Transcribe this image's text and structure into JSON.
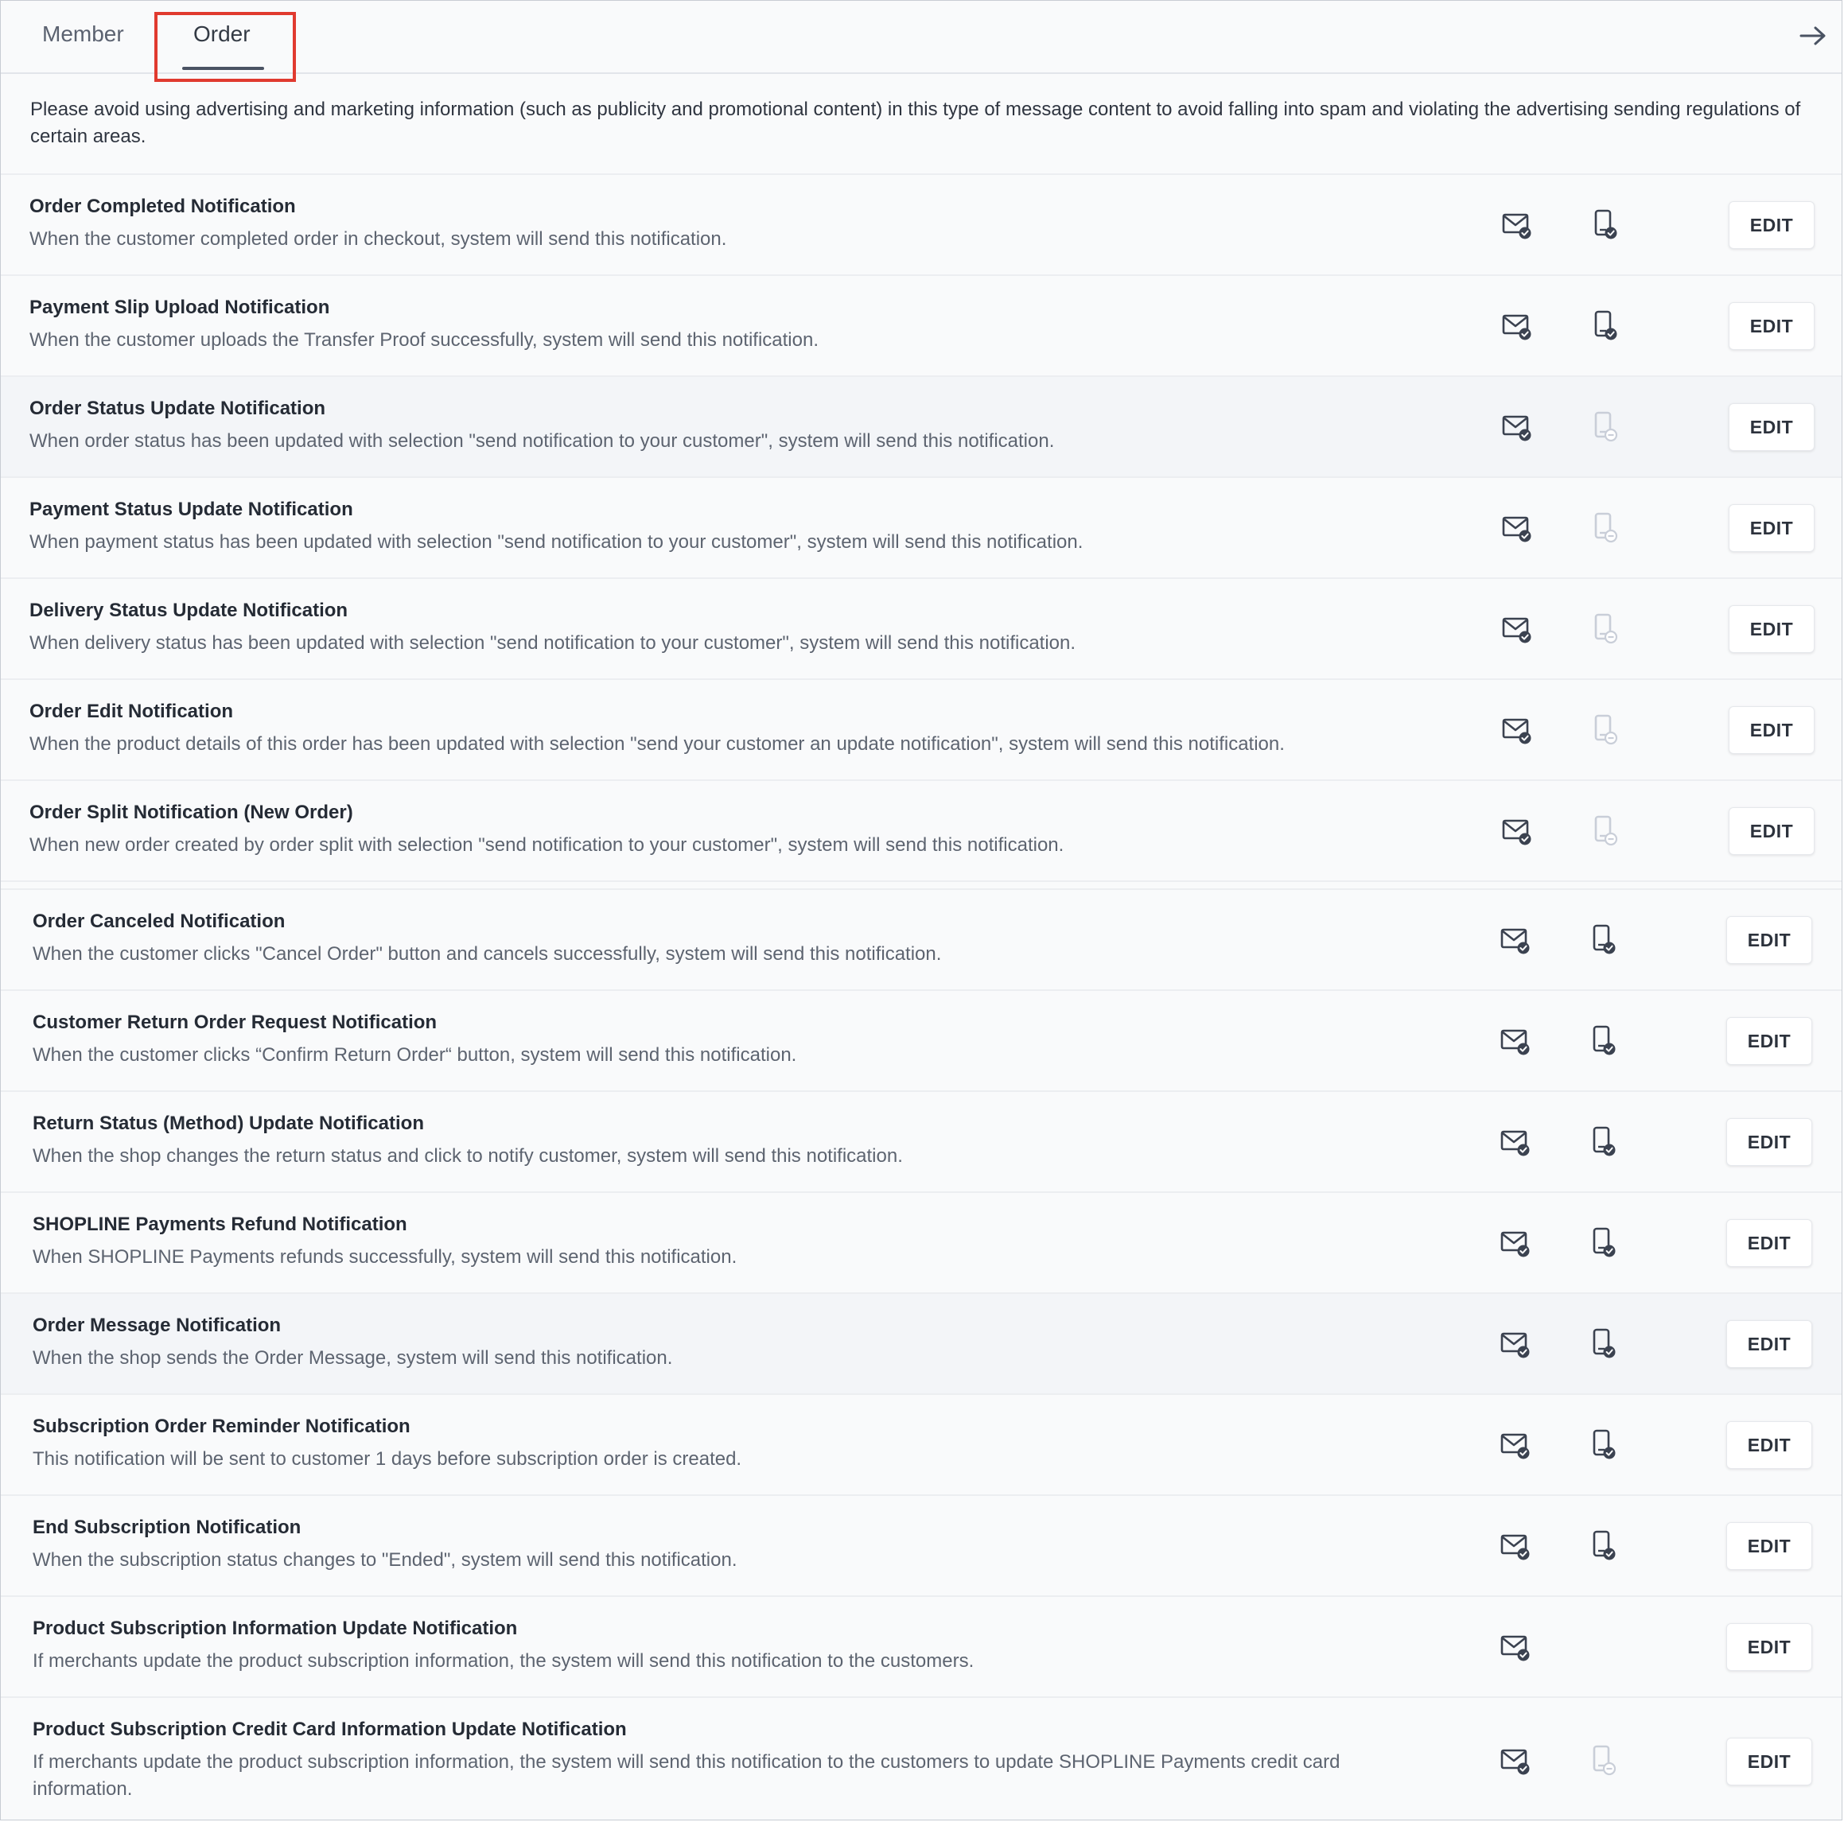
{
  "tabs": {
    "member": "Member",
    "order": "Order"
  },
  "notice": "Please avoid using advertising and marketing information (such as publicity and promotional content) in this type of message content to avoid falling into spam and violating the advertising sending regulations of certain areas.",
  "edit_label": "EDIT",
  "icons": {
    "email": "email-check-icon",
    "sms_enabled": "phone-check-icon",
    "sms_disabled": "phone-disabled-icon",
    "arrow": "arrow-right-icon"
  },
  "colors": {
    "highlight_border": "#e03a2f",
    "icon_dark": "#3b4250",
    "icon_disabled": "#c9ced8"
  },
  "rows": [
    {
      "title": "Order Completed Notification",
      "desc": "When the customer completed order in checkout, system will send this notification.",
      "sms": "enabled"
    },
    {
      "title": "Payment Slip Upload Notification",
      "desc": "When the customer uploads the Transfer Proof successfully, system will send this notification.",
      "sms": "enabled"
    },
    {
      "title": "Order Status Update Notification",
      "desc": "When order status has been updated with selection \"send notification to your customer\", system will send this notification.",
      "sms": "disabled"
    },
    {
      "title": "Payment Status Update Notification",
      "desc": "When payment status has been updated with selection \"send notification to your customer\", system will send this notification.",
      "sms": "disabled"
    },
    {
      "title": "Delivery Status Update Notification",
      "desc": "When delivery status has been updated with selection \"send notification to your customer\", system will send this notification.",
      "sms": "disabled"
    },
    {
      "title": "Order Edit Notification",
      "desc": "When the product details of this order has been updated with selection \"send your customer an update notification\", system will send this notification.",
      "sms": "disabled"
    },
    {
      "title": "Order Split Notification (New Order)",
      "desc": "When new order created by order split with selection \"send notification to your customer\", system will send this notification.",
      "sms": "disabled"
    },
    {
      "title": "Order Canceled Notification",
      "desc": "When the customer clicks \"Cancel Order\" button and cancels successfully, system will send this notification.",
      "sms": "enabled"
    },
    {
      "title": "Customer Return Order Request Notification",
      "desc": "When the customer clicks “Confirm Return Order“ button, system will send this notification.",
      "sms": "enabled"
    },
    {
      "title": "Return Status (Method) Update Notification",
      "desc": "When the shop changes the return status and click to notify customer, system will send this notification.",
      "sms": "enabled"
    },
    {
      "title": "SHOPLINE Payments Refund Notification",
      "desc": "When SHOPLINE Payments refunds successfully, system will send this notification.",
      "sms": "enabled"
    },
    {
      "title": "Order Message Notification",
      "desc": "When the shop sends the Order Message, system will send this notification.",
      "sms": "enabled"
    },
    {
      "title": "Subscription Order Reminder Notification",
      "desc": "This notification will be sent to customer 1 days before subscription order is created.",
      "sms": "enabled"
    },
    {
      "title": "End Subscription Notification",
      "desc": "When the subscription status changes to \"Ended\", system will send this notification.",
      "sms": "enabled"
    },
    {
      "title": "Product Subscription Information Update Notification",
      "desc": "If merchants update the product subscription information, the system will send this notification to the customers.",
      "sms": "none"
    },
    {
      "title": "Product Subscription Credit Card Information Update Notification",
      "desc": "If merchants update the product subscription information, the system will send this notification to the customers to update SHOPLINE Payments credit card information.",
      "sms": "disabled"
    }
  ]
}
